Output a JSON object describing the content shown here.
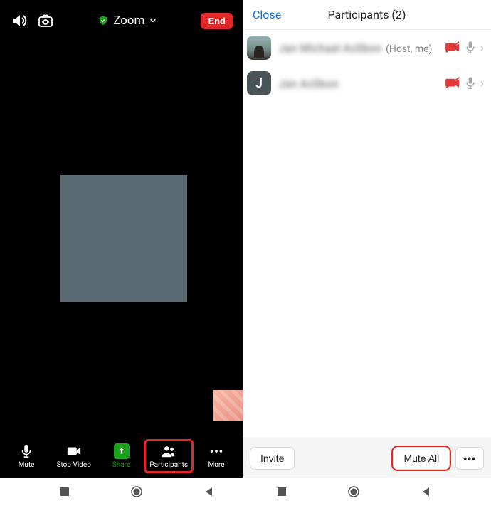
{
  "topbar": {
    "title": "Zoom",
    "end": "End"
  },
  "toolbar": {
    "mute": "Mute",
    "stopvideo": "Stop Video",
    "share": "Share",
    "participants": "Participants",
    "more": "More"
  },
  "panel": {
    "close": "Close",
    "title": "Participants (2)"
  },
  "rows": [
    {
      "name": "Jan Michael Aclibon",
      "meta": "(Host, me)",
      "letter": ""
    },
    {
      "name": "Jan Aclibon",
      "meta": "",
      "letter": "J"
    }
  ],
  "footer": {
    "invite": "Invite",
    "muteall": "Mute All",
    "more": "•••"
  }
}
